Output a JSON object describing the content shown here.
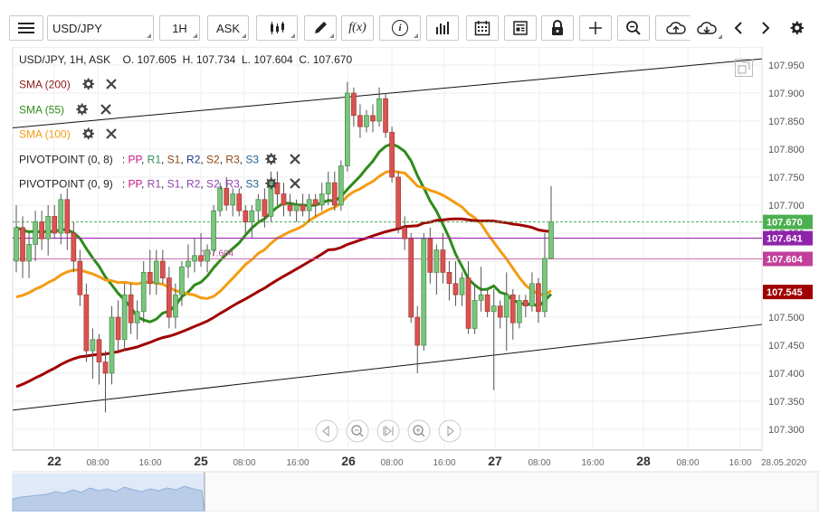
{
  "toolbar": {
    "symbol": "USD/JPY",
    "timeframe": "1H",
    "price_type": "ASK",
    "fx_label": "f(x)",
    "info_label": "i"
  },
  "ohlc": {
    "label": "USD/JPY, 1H, ASK",
    "open_label": "O.",
    "open": "107.605",
    "high_label": "H.",
    "high": "107.734",
    "low_label": "L.",
    "low": "107.604",
    "close_label": "C.",
    "close": "107.670"
  },
  "indicators": [
    {
      "name": "SMA (200)",
      "color": "#8b1a1a"
    },
    {
      "name": "SMA (55)",
      "color": "#2e8b1a"
    },
    {
      "name": "SMA (100)",
      "color": "#f39c12"
    },
    {
      "name": "PIVOTPOINT (0, 8)",
      "color": "#222222"
    },
    {
      "name": "PIVOTPOINT (0, 9)",
      "color": "#222222"
    }
  ],
  "pivot_labels": {
    "sep": ":",
    "pp": "PP",
    "r1": "R1",
    "s1": "S1",
    "r2": "R2",
    "s2": "S2",
    "r3": "R3",
    "s3": "S3",
    "pp_color": "#c71585",
    "r1_color": "#2e8b57",
    "s1_color": "#8b4513",
    "r2_color": "#1e3a8a",
    "s2_color": "#8b4513",
    "r3_color": "#8b4513",
    "s3_color": "#1e6091"
  },
  "chart_data": {
    "type": "candlestick",
    "symbol": "USD/JPY",
    "ylim": [
      107.27,
      107.97
    ],
    "y_ticks": [
      "107.950",
      "107.900",
      "107.850",
      "107.800",
      "107.750",
      "107.700",
      "107.650",
      "107.600",
      "107.550",
      "107.500",
      "107.450",
      "107.400",
      "107.350",
      "107.300"
    ],
    "x_ticks": [
      "22",
      "08:00",
      "16:00",
      "25",
      "08:00",
      "16:00",
      "26",
      "08:00",
      "16:00",
      "27",
      "08:00",
      "16:00",
      "28",
      "08:00",
      "16:00",
      "28.05.2020"
    ],
    "price_tags": [
      {
        "value": "107.670",
        "color": "#4caf50"
      },
      {
        "value": "107.641",
        "color": "#8e24aa"
      },
      {
        "value": "107.604",
        "color": "#c2409a"
      },
      {
        "value": "107.545",
        "color": "#a00000"
      }
    ],
    "level_label": "107.604",
    "candles": [
      [
        107.6,
        107.7,
        107.58,
        107.66
      ],
      [
        107.66,
        107.68,
        107.57,
        107.6
      ],
      [
        107.6,
        107.65,
        107.57,
        107.63
      ],
      [
        107.63,
        107.69,
        107.6,
        107.67
      ],
      [
        107.67,
        107.69,
        107.62,
        107.64
      ],
      [
        107.64,
        107.7,
        107.61,
        107.68
      ],
      [
        107.68,
        107.7,
        107.64,
        107.65
      ],
      [
        107.65,
        107.72,
        107.63,
        107.71
      ],
      [
        107.71,
        107.73,
        107.62,
        107.65
      ],
      [
        107.65,
        107.67,
        107.58,
        107.6
      ],
      [
        107.6,
        107.62,
        107.52,
        107.54
      ],
      [
        107.54,
        107.56,
        107.42,
        107.44
      ],
      [
        107.44,
        107.48,
        107.39,
        107.46
      ],
      [
        107.46,
        107.47,
        107.38,
        107.42
      ],
      [
        107.42,
        107.44,
        107.33,
        107.4
      ],
      [
        107.4,
        107.52,
        107.38,
        107.5
      ],
      [
        107.5,
        107.53,
        107.44,
        107.46
      ],
      [
        107.46,
        107.56,
        107.44,
        107.54
      ],
      [
        107.54,
        107.56,
        107.47,
        107.49
      ],
      [
        107.49,
        107.53,
        107.46,
        107.51
      ],
      [
        107.51,
        107.6,
        107.49,
        107.58
      ],
      [
        107.58,
        107.62,
        107.54,
        107.56
      ],
      [
        107.56,
        107.62,
        107.54,
        107.6
      ],
      [
        107.6,
        107.62,
        107.56,
        107.57
      ],
      [
        107.57,
        107.59,
        107.48,
        107.5
      ],
      [
        107.5,
        107.56,
        107.48,
        107.54
      ],
      [
        107.54,
        107.6,
        107.52,
        107.59
      ],
      [
        107.59,
        107.63,
        107.57,
        107.6
      ],
      [
        107.6,
        107.64,
        107.58,
        107.61
      ],
      [
        107.61,
        107.65,
        107.59,
        107.6
      ],
      [
        107.6,
        107.63,
        107.58,
        107.62
      ],
      [
        107.62,
        107.7,
        107.61,
        107.69
      ],
      [
        107.69,
        107.74,
        107.68,
        107.73
      ],
      [
        107.73,
        107.75,
        107.69,
        107.7
      ],
      [
        107.7,
        107.73,
        107.68,
        107.72
      ],
      [
        107.72,
        107.73,
        107.68,
        107.69
      ],
      [
        107.69,
        107.7,
        107.65,
        107.67
      ],
      [
        107.67,
        107.7,
        107.64,
        107.69
      ],
      [
        107.69,
        107.72,
        107.67,
        107.71
      ],
      [
        107.71,
        107.73,
        107.66,
        107.68
      ],
      [
        107.68,
        107.76,
        107.67,
        107.74
      ],
      [
        107.74,
        107.76,
        107.7,
        107.72
      ],
      [
        107.72,
        107.74,
        107.68,
        107.7
      ],
      [
        107.7,
        107.72,
        107.68,
        107.69
      ],
      [
        107.69,
        107.71,
        107.67,
        107.7
      ],
      [
        107.7,
        107.72,
        107.68,
        107.69
      ],
      [
        107.69,
        107.72,
        107.67,
        107.71
      ],
      [
        107.71,
        107.72,
        107.68,
        107.7
      ],
      [
        107.7,
        107.74,
        107.69,
        107.72
      ],
      [
        107.72,
        107.76,
        107.7,
        107.74
      ],
      [
        107.74,
        107.76,
        107.69,
        107.7
      ],
      [
        107.7,
        107.78,
        107.69,
        107.77
      ],
      [
        107.77,
        107.92,
        107.76,
        107.9
      ],
      [
        107.9,
        107.91,
        107.84,
        107.86
      ],
      [
        107.86,
        107.88,
        107.82,
        107.84
      ],
      [
        107.84,
        107.87,
        107.83,
        107.86
      ],
      [
        107.86,
        107.88,
        107.83,
        107.85
      ],
      [
        107.85,
        107.91,
        107.84,
        107.89
      ],
      [
        107.89,
        107.9,
        107.82,
        107.83
      ],
      [
        107.83,
        107.84,
        107.74,
        107.75
      ],
      [
        107.75,
        107.76,
        107.65,
        107.66
      ],
      [
        107.66,
        107.68,
        107.62,
        107.64
      ],
      [
        107.64,
        107.65,
        107.49,
        107.5
      ],
      [
        107.5,
        107.52,
        107.4,
        107.45
      ],
      [
        107.45,
        107.65,
        107.44,
        107.64
      ],
      [
        107.64,
        107.66,
        107.56,
        107.58
      ],
      [
        107.58,
        107.63,
        107.54,
        107.62
      ],
      [
        107.62,
        107.65,
        107.56,
        107.58
      ],
      [
        107.58,
        107.6,
        107.53,
        107.56
      ],
      [
        107.56,
        107.6,
        107.52,
        107.54
      ],
      [
        107.54,
        107.58,
        107.52,
        107.57
      ],
      [
        107.57,
        107.6,
        107.47,
        107.48
      ],
      [
        107.48,
        107.56,
        107.47,
        107.53
      ],
      [
        107.53,
        107.59,
        107.51,
        107.54
      ],
      [
        107.54,
        107.55,
        107.5,
        107.51
      ],
      [
        107.51,
        107.55,
        107.37,
        107.52
      ],
      [
        107.52,
        107.53,
        107.48,
        107.5
      ],
      [
        107.5,
        107.58,
        107.44,
        107.54
      ],
      [
        107.54,
        107.55,
        107.46,
        107.49
      ],
      [
        107.49,
        107.54,
        107.48,
        107.53
      ],
      [
        107.53,
        107.54,
        107.5,
        107.52
      ],
      [
        107.52,
        107.58,
        107.51,
        107.56
      ],
      [
        107.56,
        107.57,
        107.49,
        107.51
      ],
      [
        107.51,
        107.65,
        107.5,
        107.605
      ],
      [
        107.605,
        107.734,
        107.604,
        107.67
      ]
    ]
  }
}
